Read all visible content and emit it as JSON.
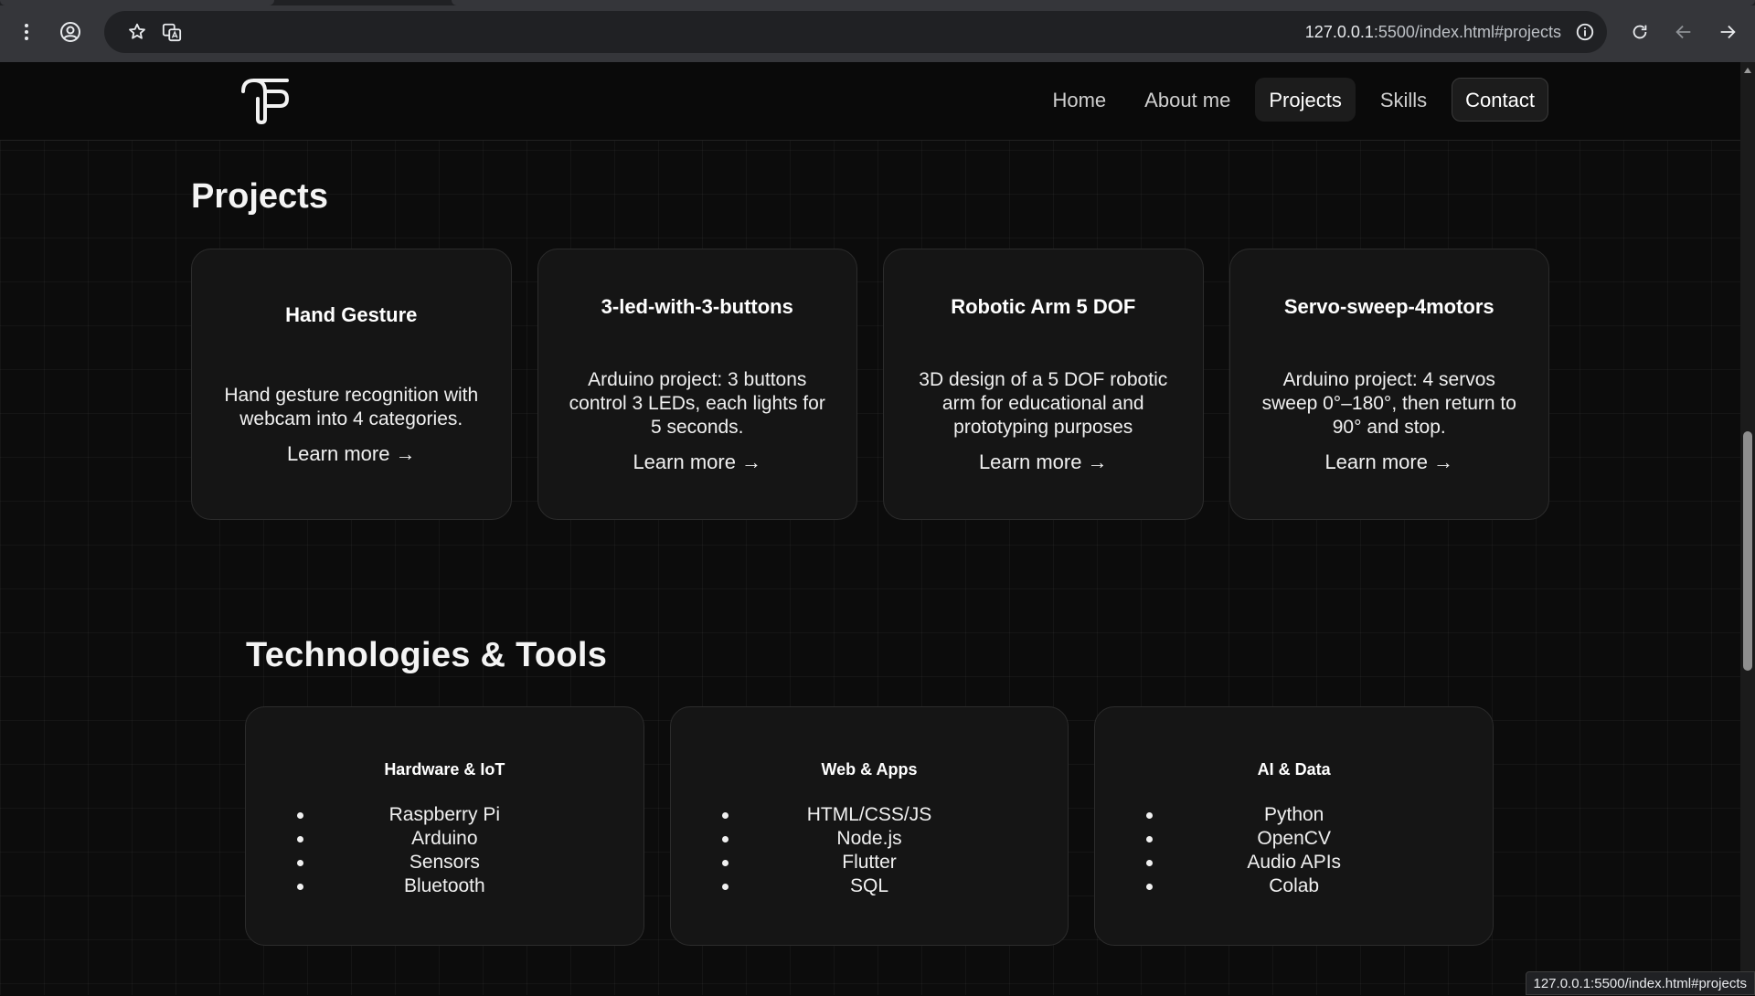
{
  "browser": {
    "url_host": "127.0.0.1",
    "url_path": ":5500/index.html#projects"
  },
  "nav": {
    "items": [
      {
        "label": "Home"
      },
      {
        "label": "About me"
      },
      {
        "label": "Projects"
      },
      {
        "label": "Skills"
      },
      {
        "label": "Contact"
      }
    ],
    "active": "Projects"
  },
  "projects": {
    "title": "Projects",
    "cards": [
      {
        "title": "Hand Gesture",
        "description": "Hand gesture recognition with webcam into 4 categories.",
        "link": "Learn more →"
      },
      {
        "title": "3-led-with-3-buttons",
        "description": "Arduino project: 3 buttons control 3 LEDs, each lights for 5 seconds.",
        "link": "Learn more →"
      },
      {
        "title": "Robotic Arm 5 DOF",
        "description": "3D design of a 5 DOF robotic arm for educational and prototyping purposes",
        "link": "Learn more →"
      },
      {
        "title": "Servo-sweep-4motors",
        "description": "Arduino project: 4 servos sweep 0°–180°, then return to 90° and stop.",
        "link": "Learn more →"
      }
    ]
  },
  "tech": {
    "title": "Technologies & Tools",
    "groups": [
      {
        "title": "Hardware & IoT",
        "items": [
          "Raspberry Pi",
          "Arduino",
          "Sensors",
          "Bluetooth"
        ]
      },
      {
        "title": "Web & Apps",
        "items": [
          "HTML/CSS/JS",
          "Node.js",
          "Flutter",
          "SQL"
        ]
      },
      {
        "title": "AI & Data",
        "items": [
          "Python",
          "OpenCV",
          "Audio APIs",
          "Colab"
        ]
      }
    ]
  },
  "status_bar": {
    "link_preview": "127.0.0.1:5500/index.html#projects"
  },
  "colors": {
    "page_bg": "#0c0c0c",
    "card_bg": "#151515",
    "card_border": "#2c2c2c",
    "chrome_bg": "#35363a"
  }
}
